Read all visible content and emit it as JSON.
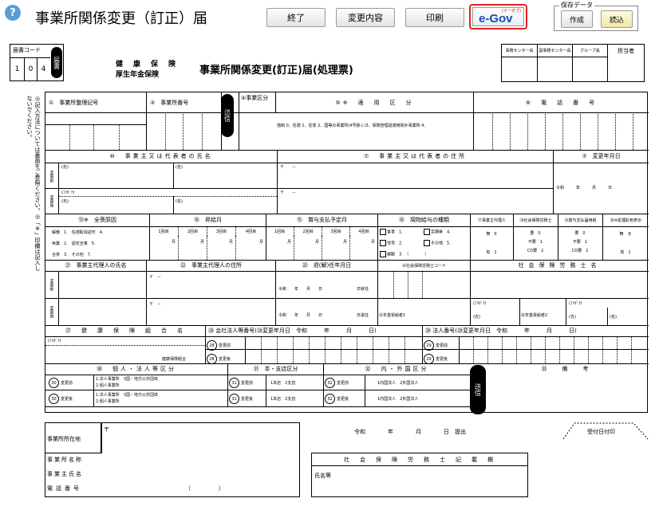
{
  "header": {
    "help_glyph": "?",
    "title": "事業所関係変更（訂正）届",
    "buttons": {
      "end": "終了",
      "changes": "変更内容",
      "print": "印刷"
    },
    "egov": {
      "logo": "e-Gov",
      "kana": "(イーガブ)"
    },
    "save_data": {
      "legend": "保存データ",
      "create": "作成",
      "load": "読込"
    }
  },
  "form_code": {
    "label": "届書コード",
    "digits": [
      "1",
      "0",
      "4"
    ],
    "pill": "届書"
  },
  "org_lines": [
    "健　康　保　険",
    "厚生年金保険"
  ],
  "form_title": "事業所関係変更(訂正)届(処理票)",
  "center_box": {
    "cols": [
      "事務センター長",
      "副事務センター長",
      "グループ長",
      "担当者"
    ]
  },
  "side_note": "◎記入方法については裏面をご参照ください。◎「※」印欄は記入しないでください。",
  "sec1": {
    "h1": "①　事業所整理記号",
    "h2": "②　事業所番号",
    "send": "送信",
    "h4": "④事業区分",
    "h5": "⑤※　適　用　区　分",
    "h6": "⑥　電　話　番　号",
    "line5": "強制 0、任適 1、任意 2、国等の事業所(4号除く)3、保険管理退適用除外事業所 4、"
  },
  "sec2": {
    "h_name": "⑩　事業主又は代表者の氏名",
    "h_addr": "⑦　事業主又は代表者の住所",
    "h_date": "⑦　変更年月日",
    "row_before": "変更前",
    "row_after": "変更後",
    "shi": "(氏)",
    "na": "(名)",
    "kana": "(ﾌﾘｶﾞﾅ)",
    "postal": "〒　　－",
    "date_vals": "令和　　　年　　　月　　　日"
  },
  "sec3": {
    "h_reason": "⑬※　全喪原因",
    "h_pay": "⑭　昇給月",
    "h_bonus": "⑮　賞与支払予定月",
    "h_kind": "⑯　現物給与の種類",
    "reasons": [
      "解散　1.　任適取消認可　4.",
      "休業　2.　認定全喪　5.",
      "合併　3.　その他　7."
    ],
    "months": [
      "1回目",
      "2回目",
      "3回目",
      "4回目"
    ],
    "month_unit": "月",
    "kinds": [
      "食事　1.",
      "住宅　2.",
      "被服　3.　（　　　　）",
      "定期券　4.",
      "その他　5."
    ],
    "c17": "⑰事業主代理人",
    "c18": "⑱社会保険労務士",
    "c19": "⑲賞与支払届用紙",
    "c20": "⑳※処理彩色表示",
    "v17": [
      "無　0",
      "有　1"
    ],
    "v18": [
      "要　0",
      "不要　1",
      "CD要　2"
    ],
    "v19": [
      "要　0",
      "不要　1",
      "CD要　2"
    ],
    "v20": [
      "無　ま",
      "有　1"
    ]
  },
  "sec4": {
    "h_agent_name": "㉑　事業主代理人の氏名",
    "h_agent_addr": "㉒　事業主代理人の住所",
    "h_term": "㉓　退(解)任年月日",
    "h_sr": "㉔社会保険労務士コード",
    "h_sr_name": "社会保険労務士名",
    "postal": "〒　－",
    "date": "令和　　年　　月　　日",
    "date_tail1": "日就任",
    "date_tail2": "日退任",
    "kana": "(ﾌﾘｶﾞﾅ)",
    "shi": "(氏)",
    "na": "(名)",
    "reg1": "㉕年金受給者1",
    "reg2": "㉖年金受給者2"
  },
  "sec5": {
    "h_kumiai": "㉗　健　康　保　険　組　合　名",
    "h_corp": "㉘ 会社法人等番号",
    "h_corp_date": "(㉘変更年月日　令和　　　年　　　月　　　日)",
    "h_corpno": "㉙ 法人番号",
    "h_corpno_date": "(㉙変更年月日　令和　　　年　　　月　　　日)",
    "kana": "(ﾌﾘｶﾞﾅ)",
    "kumiai_tail": "健康保険組合",
    "before": "変更前",
    "after": "変更後"
  },
  "sec6": {
    "h1": "㉚　個人・法人等区分",
    "h2": "㉛　本・支店区分",
    "h3": "㉜　内・外国区分",
    "h4": "㉝　備　考",
    "send": "送信",
    "kojin": [
      "1.法人事業所　3国・地方公共団体",
      "2.個人事業所"
    ],
    "honshi": "1本店　2支店",
    "naigai": "1内国法人　2外国法人",
    "before": "変更前",
    "after": "変更後"
  },
  "footer": {
    "addr_label": "事業所所在地",
    "postal": "〒",
    "name_label": "事業所名称",
    "owner_label": "事業主氏名",
    "tel_label": "電話番号",
    "paren": "（　　　　　）",
    "submit": "令和　　　　年　　　　月　　　　日　提出",
    "stamp": "受付日付印",
    "sr_h": "社　会　保　険　労　務　士　記　載　欄",
    "sr_name": "氏名等"
  }
}
